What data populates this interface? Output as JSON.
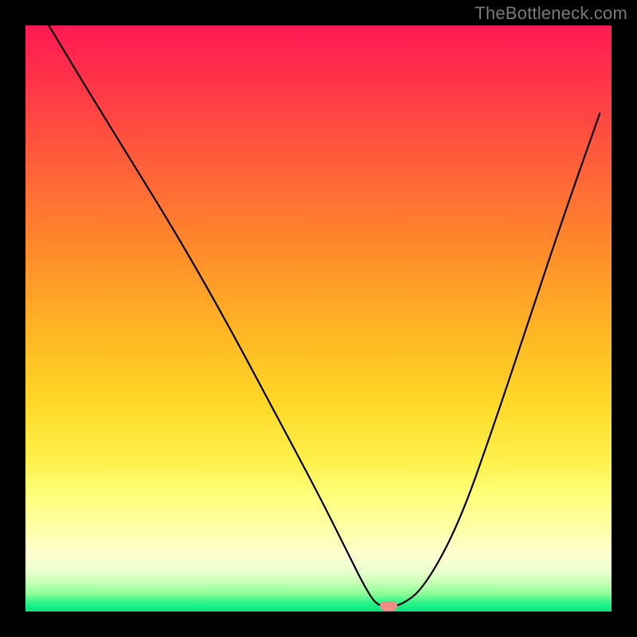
{
  "watermark": "TheBottleneck.com",
  "colors": {
    "frame": "#000000",
    "curve": "#000000",
    "marker": "#ee8d86",
    "gradient_top": "#ff1a53",
    "gradient_bottom": "#00e57a"
  },
  "chart_data": {
    "type": "line",
    "title": "",
    "xlabel": "",
    "ylabel": "",
    "xlim": [
      0,
      100
    ],
    "ylim": [
      0,
      100
    ],
    "grid": false,
    "series": [
      {
        "name": "bottleneck-curve",
        "x": [
          4,
          10,
          18,
          26,
          34,
          42,
          50,
          55,
          58,
          60,
          62,
          64,
          68,
          74,
          80,
          86,
          92,
          98
        ],
        "y": [
          100,
          90,
          77,
          64,
          50,
          35,
          20,
          10,
          4,
          1,
          1,
          1,
          4,
          15,
          32,
          50,
          68,
          85
        ]
      }
    ],
    "marker": {
      "x": 62,
      "y": 1
    }
  }
}
